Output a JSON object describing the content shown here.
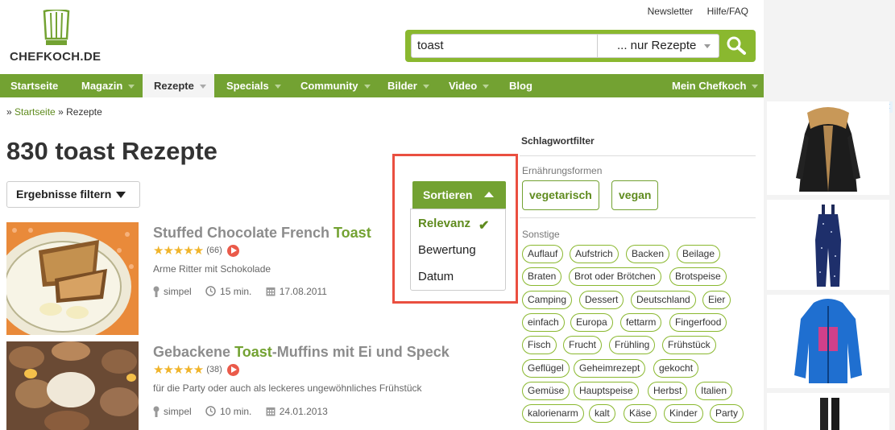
{
  "header": {
    "brand": "CHEFKOCH.DE",
    "links": [
      "Newsletter",
      "Hilfe/FAQ"
    ],
    "search_value": "toast",
    "search_scope": "... nur Rezepte"
  },
  "nav": [
    {
      "label": "Startseite",
      "dropdown": false
    },
    {
      "label": "Magazin",
      "dropdown": true
    },
    {
      "label": "Rezepte",
      "dropdown": true,
      "active": true
    },
    {
      "label": "Specials",
      "dropdown": true
    },
    {
      "label": "Community",
      "dropdown": true
    },
    {
      "label": "Bilder",
      "dropdown": true
    },
    {
      "label": "Video",
      "dropdown": true
    },
    {
      "label": "Blog",
      "dropdown": false
    },
    {
      "label": "Mein Chefkoch",
      "dropdown": true
    }
  ],
  "breadcrumb": {
    "prefix": "»",
    "home": "Startseite",
    "separator": "»",
    "current": "Rezepte"
  },
  "page_title": "830 toast Rezepte",
  "filter_button": "Ergebnisse filtern",
  "sort": {
    "label": "Sortieren",
    "options": [
      "Relevanz",
      "Bewertung",
      "Datum"
    ],
    "selected": "Relevanz"
  },
  "recipes": [
    {
      "title_parts": [
        "Stuffed Chocolate French ",
        "Toast",
        ""
      ],
      "stars": "★★★★★",
      "rating": 4.5,
      "count": "(66)",
      "subtitle": "Arme Ritter mit Schokolade",
      "difficulty": "simpel",
      "time": "15 min.",
      "date": "17.08.2011"
    },
    {
      "title_parts": [
        "Gebackene ",
        "Toast",
        "-Muffins mit Ei und Speck"
      ],
      "stars": "★★★★★",
      "rating": 4.5,
      "count": "(38)",
      "subtitle": "für die Party oder auch als leckeres ungewöhnliches Frühstück",
      "difficulty": "simpel",
      "time": "10 min.",
      "date": "24.01.2013"
    }
  ],
  "sidebar": {
    "title": "Schlagwortfilter",
    "section1": "Ernährungsformen",
    "diet_tags": [
      "vegetarisch",
      "vegan"
    ],
    "section2": "Sonstige",
    "tags": [
      [
        "Auflauf",
        "Aufstrich",
        "Backen",
        "Beilage"
      ],
      [
        "Braten",
        "Brot oder Brötchen",
        "Brotspeise"
      ],
      [
        "Camping",
        "Dessert",
        "Deutschland",
        "Eier"
      ],
      [
        "einfach",
        "Europa",
        "fettarm",
        "Fingerfood"
      ],
      [
        "Fisch",
        "Frucht",
        "Frühling",
        "Frühstück"
      ],
      [
        "Geflügel",
        "Geheimrezept",
        "gekocht"
      ],
      [
        "Gemüse",
        "Hauptspeise",
        "Herbst",
        "Italien"
      ],
      [
        "kalorienarm",
        "kalt",
        "Käse",
        "Kinder",
        "Party"
      ]
    ]
  },
  "colors": {
    "brand_green": "#73a232",
    "highlight_red": "#ea4f40",
    "star": "#f0b42a"
  }
}
